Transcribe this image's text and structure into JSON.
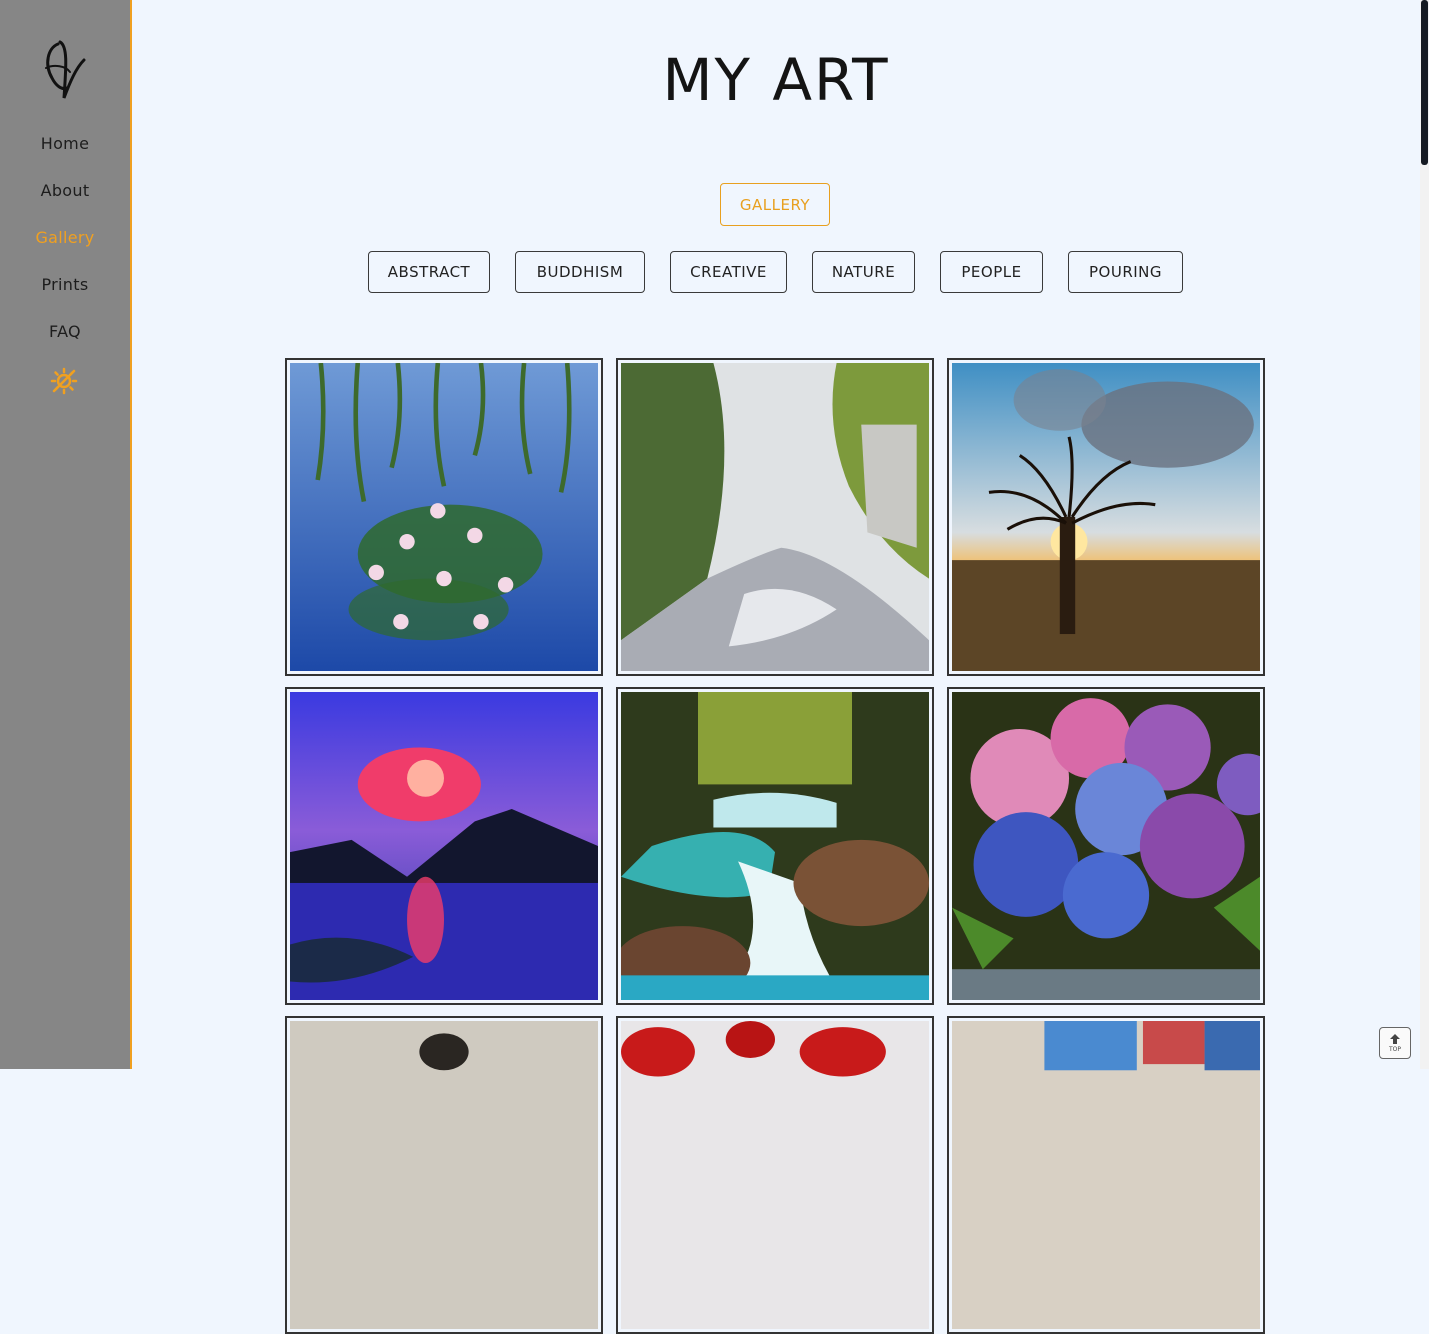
{
  "sidebar": {
    "nav": [
      {
        "label": "Home"
      },
      {
        "label": "About"
      },
      {
        "label": "Gallery",
        "active": true
      },
      {
        "label": "Prints"
      },
      {
        "label": "FAQ"
      }
    ],
    "theme_icon": "sun-icon"
  },
  "main": {
    "title": "MY ART",
    "gallery_button": "GALLERY",
    "filters": [
      "ABSTRACT",
      "BUDDHISM",
      "CREATIVE",
      "NATURE",
      "PEOPLE",
      "POURING"
    ]
  },
  "back_to_top": {
    "label": "TOP",
    "icon": "arrow-up-icon"
  },
  "colors": {
    "accent": "#f0a020",
    "sidebar_bg": "#868686",
    "page_bg": "#f0f6fe"
  }
}
